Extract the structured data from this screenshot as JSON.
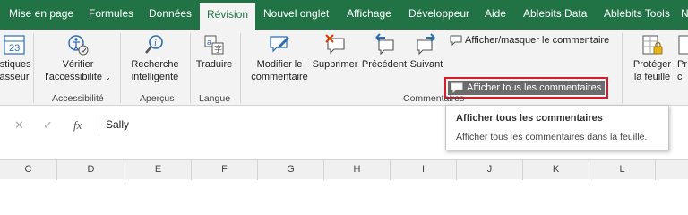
{
  "tabs": [
    {
      "label": "Mise en page"
    },
    {
      "label": "Formules"
    },
    {
      "label": "Données"
    },
    {
      "label": "Révision",
      "active": true
    },
    {
      "label": "Nouvel onglet"
    },
    {
      "label": "Affichage"
    },
    {
      "label": "Développeur"
    },
    {
      "label": "Aide"
    },
    {
      "label": "Ablebits Data"
    },
    {
      "label": "Ablebits Tools"
    },
    {
      "label": "N"
    }
  ],
  "ribbon": {
    "stats": {
      "line1": "istiques",
      "line2": "asseur",
      "icon": "statistics-icon"
    },
    "accessibility": {
      "line1": "Vérifier",
      "line2": "l'accessibilité",
      "group": "Accessibilité",
      "icon": "accessibility-check-icon"
    },
    "smart_lookup": {
      "line1": "Recherche",
      "line2": "intelligente",
      "icon": "smart-lookup-icon"
    },
    "translate": {
      "line1": "Traduire",
      "icon": "translate-icon"
    },
    "insights_group": "Aperçus",
    "language_group": "Langue",
    "edit_comment": {
      "line1": "Modifier le",
      "line2": "commentaire",
      "icon": "edit-comment-icon"
    },
    "delete": {
      "line1": "Supprimer",
      "icon": "delete-comment-icon"
    },
    "previous": {
      "line1": "Précédent",
      "icon": "previous-comment-icon"
    },
    "next": {
      "line1": "Suivant",
      "icon": "next-comment-icon"
    },
    "show_hide": {
      "label": "Afficher/masquer le commentaire",
      "icon": "show-hide-comment-icon"
    },
    "show_all": {
      "label": "Afficher tous les commentaires",
      "icon": "show-all-comments-icon"
    },
    "comments_group": "Commentaires",
    "protect_sheet": {
      "line1": "Protéger",
      "line2": "la feuille",
      "icon": "protect-sheet-icon"
    },
    "protect_wb": {
      "line1": "Pr",
      "line2": "c",
      "icon": "protect-workbook-icon"
    }
  },
  "formula_bar": {
    "cancel_icon": "✕",
    "confirm_icon": "✓",
    "fx_icon": "fx",
    "value": "Sally"
  },
  "tooltip": {
    "title": "Afficher tous les commentaires",
    "description": "Afficher tous les commentaires dans la feuille."
  },
  "columns": [
    "C",
    "D",
    "E",
    "F",
    "G",
    "H",
    "I",
    "J",
    "K",
    "L"
  ],
  "colors": {
    "accent": "#217346",
    "highlight_border": "#d61e2a"
  }
}
